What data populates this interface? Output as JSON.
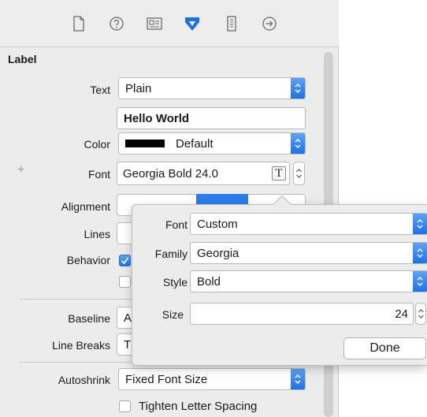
{
  "toolbar": {
    "icons": [
      "file-icon",
      "help-icon",
      "identity-icon",
      "attributes-icon",
      "size-icon",
      "connections-icon"
    ]
  },
  "section": {
    "title": "Label"
  },
  "text_row": {
    "label": "Text",
    "value": "Plain",
    "content": "Hello World"
  },
  "color_row": {
    "label": "Color",
    "value": "Default",
    "swatch": "#000000"
  },
  "font_row": {
    "label": "Font",
    "value": "Georgia Bold 24.0",
    "add_symbol": "+",
    "font_button": "T"
  },
  "alignment_row": {
    "label": "Alignment"
  },
  "lines_row": {
    "label": "Lines"
  },
  "behavior_row": {
    "label": "Behavior"
  },
  "baseline_row": {
    "label": "Baseline",
    "value": "A"
  },
  "line_breaks_row": {
    "label": "Line Breaks",
    "value": "T"
  },
  "autoshrink_row": {
    "label": "Autoshrink",
    "value": "Fixed Font Size"
  },
  "tighten": {
    "label": "Tighten Letter Spacing"
  },
  "popover": {
    "font_label": "Font",
    "font_value": "Custom",
    "family_label": "Family",
    "family_value": "Georgia",
    "style_label": "Style",
    "style_value": "Bold",
    "size_label": "Size",
    "size_value": "24",
    "done_label": "Done"
  },
  "colors": {
    "accent": "#1d6fe6",
    "panel": "#ececec"
  }
}
